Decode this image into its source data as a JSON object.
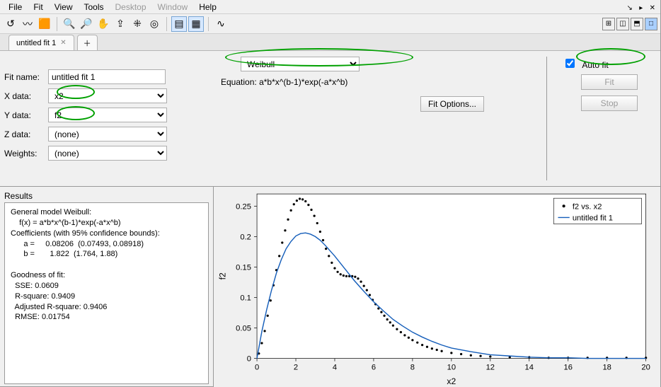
{
  "menubar": {
    "items": [
      {
        "label": "File",
        "enabled": true
      },
      {
        "label": "Fit",
        "enabled": true
      },
      {
        "label": "View",
        "enabled": true
      },
      {
        "label": "Tools",
        "enabled": true
      },
      {
        "label": "Desktop",
        "enabled": false
      },
      {
        "label": "Window",
        "enabled": false
      },
      {
        "label": "Help",
        "enabled": true
      }
    ]
  },
  "toolbar": {
    "group1": [
      "↞",
      "⇵",
      "◧"
    ],
    "group2": [
      "🔍+",
      "🔍-",
      "✋",
      "👆",
      "⤢",
      "⦿"
    ],
    "group3": [
      "▤",
      "▦"
    ],
    "group4": [
      "↯"
    ],
    "layout": [
      "⊞",
      "▥",
      "▤",
      "□"
    ]
  },
  "tabs": {
    "items": [
      {
        "label": "untitled fit 1",
        "active": true
      }
    ]
  },
  "form": {
    "fitname_label": "Fit name:",
    "fitname_value": "untitled fit 1",
    "xdata_label": "X data:",
    "xdata_value": "x2",
    "ydata_label": "Y data:",
    "ydata_value": "f2",
    "zdata_label": "Z data:",
    "zdata_value": "(none)",
    "weights_label": "Weights:",
    "weights_value": "(none)"
  },
  "fittype": {
    "selected": "Weibull",
    "equation_label": "Equation:",
    "equation_text": "a*b*x^(b-1)*exp(-a*x^b)",
    "fit_options_label": "Fit Options..."
  },
  "autofit": {
    "label": "Auto fit",
    "checked": true,
    "fit_label": "Fit",
    "stop_label": "Stop"
  },
  "results": {
    "title": "Results",
    "text": "General model Weibull:\n    f(x) = a*b*x^(b-1)*exp(-a*x^b)\nCoefficients (with 95% confidence bounds):\n      a =     0.08206  (0.07493, 0.08918)\n      b =       1.822  (1.764, 1.88)\n\nGoodness of fit:\n  SSE: 0.0609\n  R-square: 0.9409\n  Adjusted R-square: 0.9406\n  RMSE: 0.01754"
  },
  "chart_data": {
    "type": "line+scatter",
    "xlabel": "x2",
    "ylabel": "f2",
    "xlim": [
      0,
      20
    ],
    "ylim": [
      0,
      0.27
    ],
    "xticks": [
      0,
      2,
      4,
      6,
      8,
      10,
      12,
      14,
      16,
      18,
      20
    ],
    "yticks": [
      0,
      0.05,
      0.1,
      0.15,
      0.2,
      0.25
    ],
    "legend": [
      "f2 vs. x2",
      "untitled fit 1"
    ],
    "series": [
      {
        "name": "f2 vs. x2",
        "type": "scatter",
        "color": "#000000",
        "x": [
          0.1,
          0.25,
          0.4,
          0.55,
          0.7,
          0.85,
          1.0,
          1.15,
          1.3,
          1.45,
          1.6,
          1.75,
          1.9,
          2.05,
          2.2,
          2.35,
          2.5,
          2.65,
          2.8,
          2.95,
          3.1,
          3.25,
          3.4,
          3.55,
          3.7,
          3.85,
          4.0,
          4.15,
          4.3,
          4.45,
          4.6,
          4.75,
          4.9,
          5.05,
          5.2,
          5.35,
          5.5,
          5.65,
          5.8,
          5.95,
          6.1,
          6.25,
          6.4,
          6.55,
          6.7,
          6.85,
          7.0,
          7.2,
          7.4,
          7.6,
          7.8,
          8.0,
          8.25,
          8.5,
          8.75,
          9.0,
          9.25,
          9.5,
          10.0,
          10.5,
          11.0,
          11.5,
          12.0,
          13.0,
          14.0,
          15.0,
          16.0,
          17.0,
          18.0,
          19.0,
          20.0
        ],
        "y": [
          0.008,
          0.025,
          0.045,
          0.07,
          0.095,
          0.12,
          0.145,
          0.168,
          0.19,
          0.21,
          0.228,
          0.243,
          0.253,
          0.259,
          0.262,
          0.261,
          0.258,
          0.252,
          0.244,
          0.234,
          0.222,
          0.208,
          0.194,
          0.18,
          0.168,
          0.157,
          0.148,
          0.142,
          0.138,
          0.136,
          0.135,
          0.135,
          0.135,
          0.134,
          0.131,
          0.126,
          0.119,
          0.112,
          0.104,
          0.096,
          0.089,
          0.082,
          0.076,
          0.07,
          0.064,
          0.059,
          0.054,
          0.048,
          0.043,
          0.038,
          0.034,
          0.03,
          0.026,
          0.022,
          0.019,
          0.016,
          0.014,
          0.012,
          0.009,
          0.007,
          0.005,
          0.004,
          0.003,
          0.002,
          0.002,
          0.001,
          0.001,
          0.001,
          0.001,
          0.001,
          0.001
        ]
      },
      {
        "name": "untitled fit 1",
        "type": "line",
        "color": "#155eba",
        "x": [
          0.0,
          0.25,
          0.5,
          0.75,
          1.0,
          1.25,
          1.5,
          1.75,
          2.0,
          2.25,
          2.5,
          2.75,
          3.0,
          3.25,
          3.5,
          3.75,
          4.0,
          4.25,
          4.5,
          4.75,
          5.0,
          5.5,
          6.0,
          6.5,
          7.0,
          7.5,
          8.0,
          8.5,
          9.0,
          9.5,
          10.0,
          11.0,
          12.0,
          13.0,
          14.0,
          15.0,
          16.0,
          17.0,
          18.0,
          19.0,
          20.0
        ],
        "y": [
          0.0,
          0.044,
          0.08,
          0.112,
          0.14,
          0.162,
          0.18,
          0.192,
          0.201,
          0.205,
          0.206,
          0.204,
          0.2,
          0.194,
          0.186,
          0.177,
          0.168,
          0.158,
          0.148,
          0.138,
          0.128,
          0.11,
          0.093,
          0.078,
          0.064,
          0.053,
          0.043,
          0.035,
          0.028,
          0.022,
          0.017,
          0.011,
          0.006,
          0.004,
          0.002,
          0.001,
          0.001,
          0.0,
          0.0,
          0.0,
          0.0
        ]
      }
    ]
  }
}
